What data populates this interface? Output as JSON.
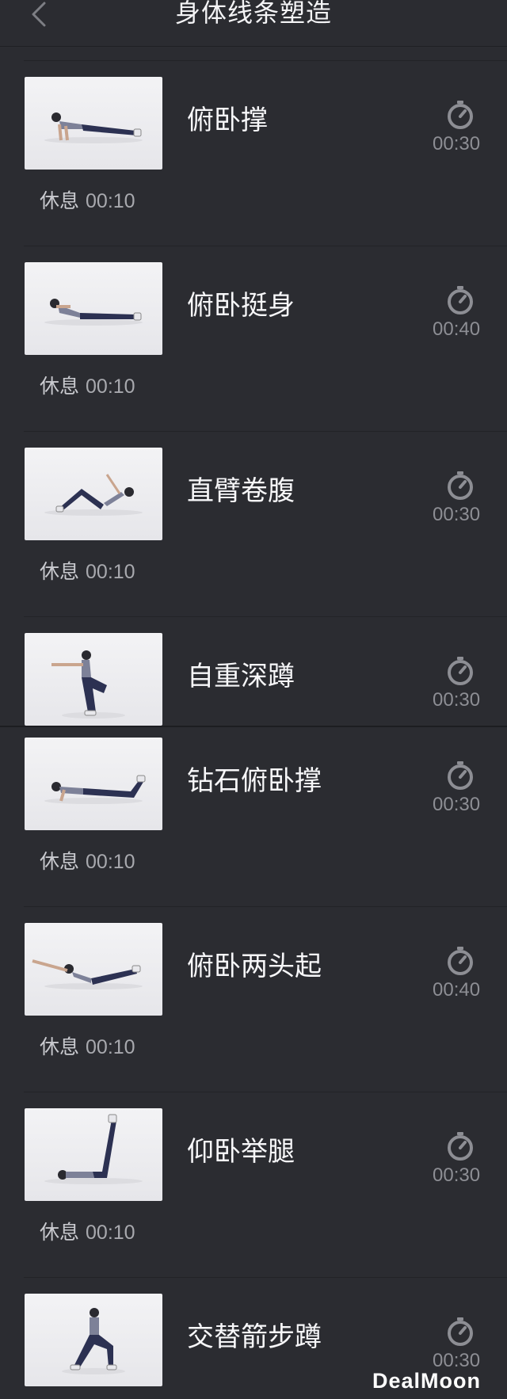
{
  "header": {
    "title": "身体线条塑造",
    "back_icon": "chevron-left-icon"
  },
  "rest_label": "休息",
  "timer_icon": "stopwatch-icon",
  "exercises": [
    {
      "name": "俯卧撑",
      "duration": "00:30",
      "rest": "00:10",
      "pose": "plank"
    },
    {
      "name": "俯卧挺身",
      "duration": "00:40",
      "rest": "00:10",
      "pose": "back-extension"
    },
    {
      "name": "直臂卷腹",
      "duration": "00:30",
      "rest": "00:10",
      "pose": "crunch"
    },
    {
      "name": "自重深蹲",
      "duration": "00:30",
      "rest": "",
      "pose": "squat"
    },
    {
      "name": "钻石俯卧撑",
      "duration": "00:30",
      "rest": "00:10",
      "pose": "diamond-pushup"
    },
    {
      "name": "俯卧两头起",
      "duration": "00:40",
      "rest": "00:10",
      "pose": "superman"
    },
    {
      "name": "仰卧举腿",
      "duration": "00:30",
      "rest": "00:10",
      "pose": "leg-raise"
    },
    {
      "name": "交替箭步蹲",
      "duration": "00:30",
      "rest": "",
      "pose": "lunge"
    }
  ],
  "watermark": "DealMoon",
  "colors": {
    "background": "#2b2c31",
    "text": "#f2f2f4",
    "muted": "#8d8e94"
  }
}
